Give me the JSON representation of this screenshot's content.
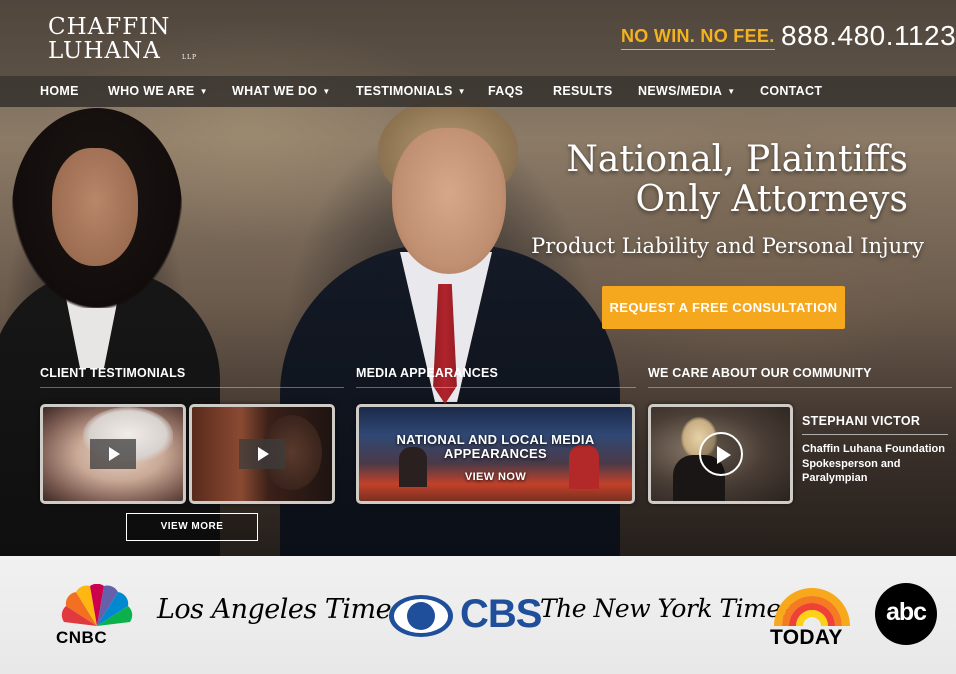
{
  "header": {
    "logo_line1": "Chaffin",
    "logo_line2": "Luhana",
    "logo_suffix": "LLP",
    "tagline": "NO WIN. NO FEE.",
    "phone": "888.480.1123"
  },
  "nav": {
    "items": [
      {
        "label": "HOME",
        "dropdown": false
      },
      {
        "label": "WHO WE ARE",
        "dropdown": true
      },
      {
        "label": "WHAT WE DO",
        "dropdown": true
      },
      {
        "label": "TESTIMONIALS",
        "dropdown": true
      },
      {
        "label": "FAQS",
        "dropdown": false
      },
      {
        "label": "RESULTS",
        "dropdown": false
      },
      {
        "label": "NEWS/MEDIA",
        "dropdown": true
      },
      {
        "label": "CONTACT",
        "dropdown": false
      }
    ]
  },
  "hero": {
    "headline_line1": "National, Plaintiffs",
    "headline_line2": "Only Attorneys",
    "subheadline": "Product Liability and Personal Injury",
    "cta_label": "REQUEST A FREE CONSULTATION"
  },
  "sections": {
    "testimonials": {
      "title": "CLIENT TESTIMONIALS",
      "view_more": "VIEW MORE"
    },
    "media": {
      "title": "MEDIA APPEARANCES",
      "card_title": "NATIONAL AND LOCAL MEDIA APPEARANCES",
      "card_link": "VIEW NOW"
    },
    "community": {
      "title": "WE CARE ABOUT OUR COMMUNITY",
      "person_name": "STEPHANI VICTOR",
      "person_desc": "Chaffin Luhana Foundation Spokesperson and Paralympian"
    }
  },
  "press": {
    "cnbc": "CNBC",
    "latimes": "Los Angeles Times",
    "cbs": "CBS",
    "nytimes": "The New York Times",
    "today": "TODAY",
    "abc": "abc"
  },
  "colors": {
    "accent": "#f5a81d",
    "tagline": "#f5b21f",
    "cbs_blue": "#1f4e9a"
  }
}
